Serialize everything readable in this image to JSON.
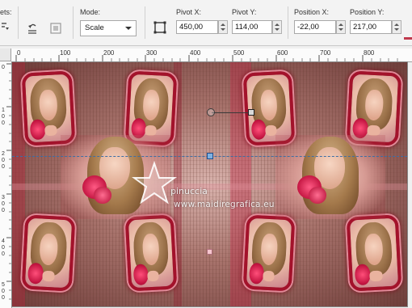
{
  "toolbar": {
    "presets_label": "ets:",
    "mode_label": "Mode:",
    "mode_value": "Scale",
    "pivot_x_label": "Pivot X:",
    "pivot_x_value": "450,00",
    "pivot_y_label": "Pivot Y:",
    "pivot_y_value": "114,00",
    "position_x_label": "Position X:",
    "position_x_value": "-22,00",
    "position_y_label": "Position Y:",
    "position_y_value": "217,00"
  },
  "ruler": {
    "h_labels": [
      "0",
      "100",
      "200",
      "300",
      "400",
      "500",
      "600",
      "700",
      "800"
    ],
    "v_labels": [
      "0",
      "100",
      "200",
      "300",
      "400",
      "500"
    ]
  },
  "watermark": {
    "name": "pinuccia",
    "site": "www.maidiregrafica.eu"
  },
  "colors": {
    "frame": "#a3122b",
    "guide": "#3c6ea6",
    "accent_border": "#c0394d"
  }
}
